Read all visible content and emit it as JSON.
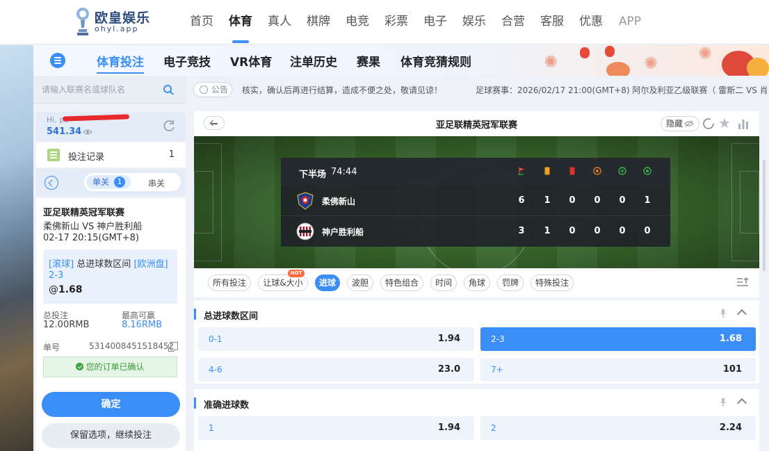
{
  "brand": {
    "name": "欧皇娱乐",
    "sub": "ohyl.app"
  },
  "topnav": [
    "首页",
    "体育",
    "真人",
    "棋牌",
    "电竞",
    "彩票",
    "电子",
    "娱乐",
    "合营",
    "客服",
    "优惠",
    "APP"
  ],
  "subnav": [
    "体育投注",
    "电子竞技",
    "VR体育",
    "注单历史",
    "赛果",
    "体育竞猜规则"
  ],
  "search": {
    "placeholder": "请输入联赛名或球队名"
  },
  "account": {
    "greeting": "Hi, p5",
    "balance": "541.34"
  },
  "bet_record": {
    "label": "投注记录",
    "count": "1"
  },
  "slip_tabs": {
    "single": "单关",
    "single_count": "1",
    "parlay": "串关"
  },
  "slip": {
    "league": "亚足联精英冠军联赛",
    "match": "柔佛新山 VS 神户胜利船",
    "time": "02-17 20:15(GMT+8)",
    "tag_live": "[滚球]",
    "market": "总进球数区间",
    "tag_odds": "[欧洲盘]",
    "selection": "2-3",
    "odds_prefix": "@",
    "odds": "1.68",
    "stake_label": "总投注",
    "stake": "12.00RMB",
    "win_label": "最高可赢",
    "win": "8.16RMB",
    "order_label": "单号",
    "order_no": "5314008451518452",
    "confirmed": "您的订单已确认",
    "confirm_btn": "确定",
    "keep_btn": "保留选项，继续投注"
  },
  "notice": {
    "label": "公告",
    "text": "核实，确认后再进行结算，造成不便之处，敬请见谅！",
    "text2": "足球赛事：2026/02/17 21:00(GMT+8) 阿尔及利亚乙级联赛（ 雷斯二 VS 肖"
  },
  "match": {
    "title": "亚足联精英冠军联赛",
    "hide_label": "隐藏",
    "period": "下半场",
    "clock": "74:44",
    "stat_icons": [
      "corner-flag-icon",
      "yellow-card-icon",
      "red-card-icon",
      "penalty-icon",
      "half-time-icon",
      "full-time-icon"
    ],
    "colors": {
      "corner": "#e04a3a",
      "yellow": "#f0a020",
      "red": "#e0302a",
      "penalty": "#e07a2a",
      "green": "#3ab04a"
    },
    "teams": [
      {
        "name": "柔佛新山",
        "stats": [
          "6",
          "1",
          "0",
          "0",
          "0",
          "1"
        ]
      },
      {
        "name": "神户胜利船",
        "stats": [
          "3",
          "1",
          "0",
          "0",
          "0",
          "0"
        ]
      }
    ]
  },
  "filters": [
    "所有投注",
    "让球&大小",
    "进球",
    "波胆",
    "特色组合",
    "时间",
    "角球",
    "罚牌",
    "特殊投注"
  ],
  "filter_hot": "HOT",
  "markets": [
    {
      "title": "总进球数区间",
      "odds": [
        {
          "sel": "0-1",
          "val": "1.94"
        },
        {
          "sel": "2-3",
          "val": "1.68"
        },
        {
          "sel": "4-6",
          "val": "23.0"
        },
        {
          "sel": "7+",
          "val": "101"
        }
      ]
    },
    {
      "title": "准确进球数",
      "odds": [
        {
          "sel": "1",
          "val": "1.94"
        },
        {
          "sel": "2",
          "val": "2.24"
        }
      ]
    }
  ],
  "accent": "#3a8ef6"
}
